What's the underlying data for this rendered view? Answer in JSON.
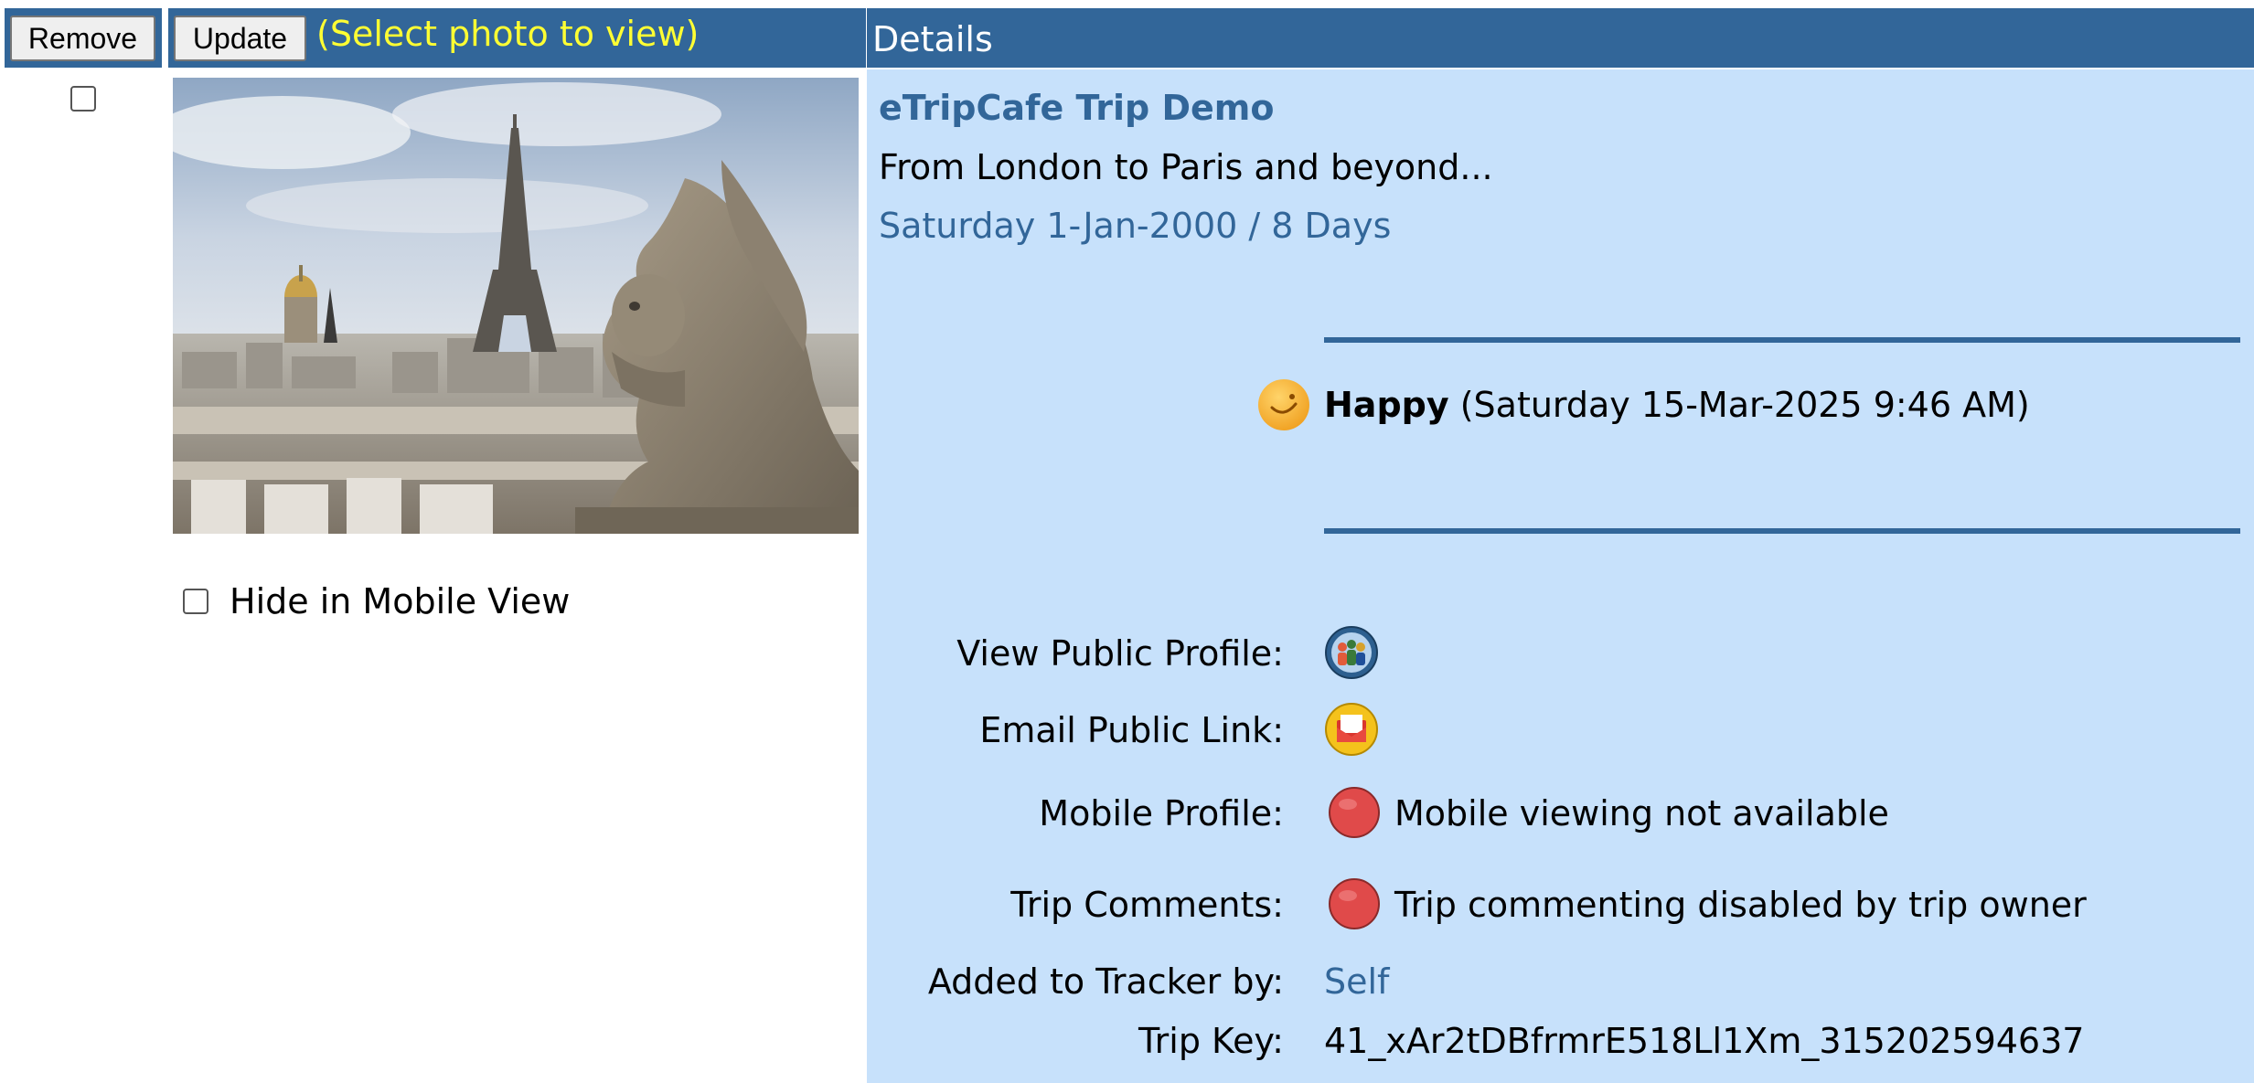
{
  "header": {
    "remove_label": "Remove",
    "update_label": "Update",
    "select_hint": "(Select photo to view)",
    "details_title": "Details"
  },
  "left": {
    "hide_mobile_label": "Hide in Mobile View"
  },
  "trip": {
    "title": "eTripCafe Trip Demo",
    "subtitle": "From London to Paris and beyond...",
    "dates": "Saturday 1-Jan-2000 / 8 Days"
  },
  "mood": {
    "icon": "smiley-icon",
    "label": "Happy",
    "timestamp": "(Saturday 15-Mar-2025 9:46 AM)"
  },
  "fields": {
    "public_profile": {
      "label": "View Public Profile:",
      "icon": "group-profile-icon"
    },
    "email_link": {
      "label": "Email Public Link:",
      "icon": "email-icon"
    },
    "mobile_profile": {
      "label": "Mobile Profile:",
      "icon": "red-status-icon",
      "value": "Mobile viewing not available"
    },
    "trip_comments": {
      "label": "Trip Comments:",
      "icon": "red-status-icon",
      "value": "Trip commenting disabled by trip owner"
    },
    "added_by": {
      "label": "Added to Tracker by:",
      "value": "Self"
    },
    "trip_key": {
      "label": "Trip Key:",
      "value": "41_xAr2tDBfrmrE518Ll1Xm_315202594637"
    }
  },
  "colors": {
    "header_bg": "#326699",
    "panel_bg": "#c7e1fb",
    "hint_yellow": "#ffff33",
    "link_blue": "#326699",
    "status_red": "#e04a4a"
  }
}
